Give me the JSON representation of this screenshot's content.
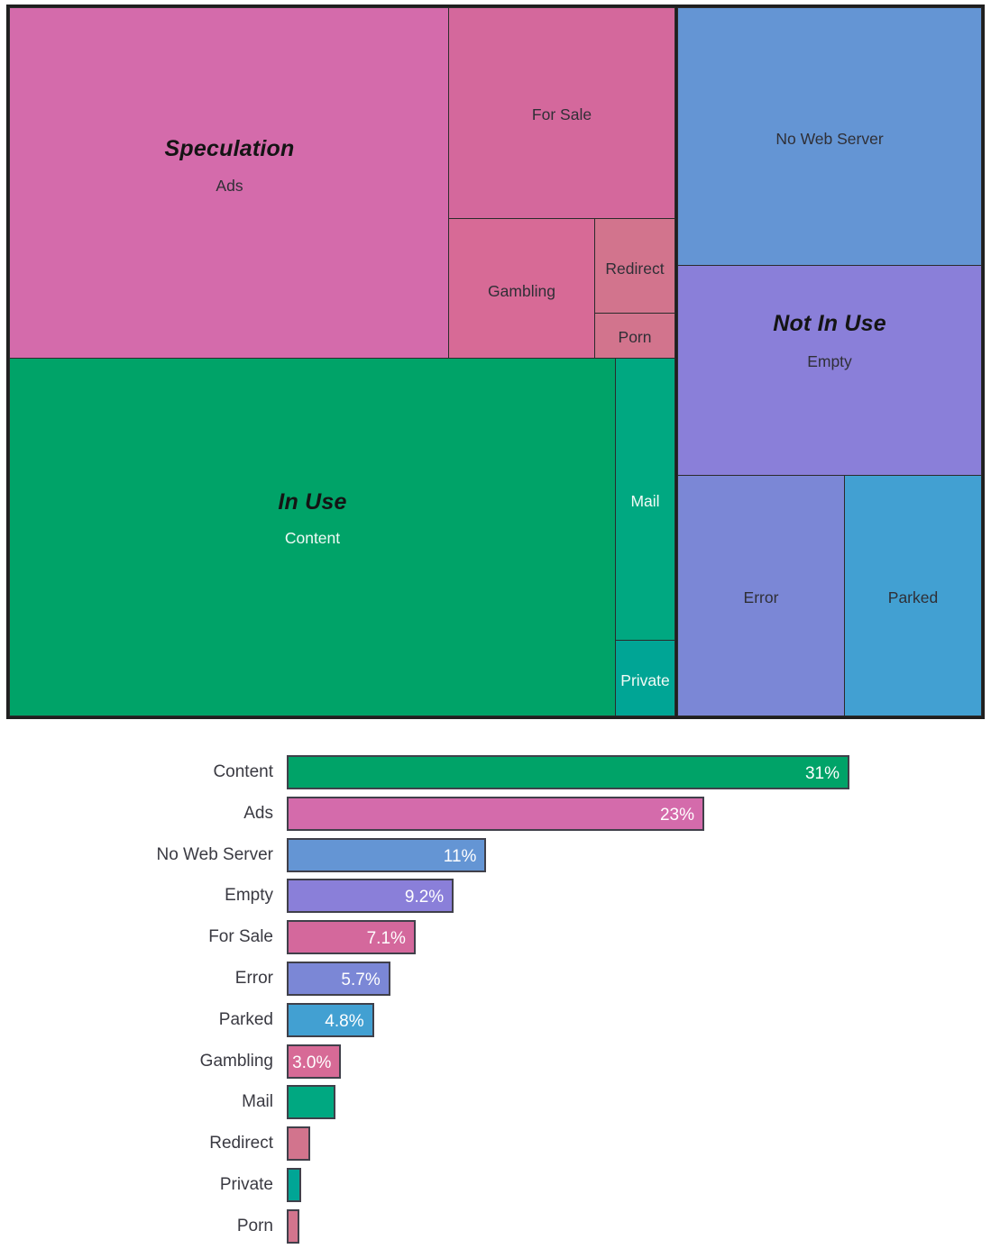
{
  "chart_data": [
    {
      "type": "treemap",
      "title": "",
      "groups": [
        {
          "name": "Speculation",
          "color": "#d46bab",
          "children": [
            {
              "label": "Ads",
              "value": 23,
              "color": "#d46bab",
              "label_color": "dark"
            },
            {
              "label": "For Sale",
              "value": 7.1,
              "color": "#d4689c",
              "label_color": "dark"
            },
            {
              "label": "Gambling",
              "value": 3.0,
              "color": "#d76a96",
              "label_color": "dark"
            },
            {
              "label": "Redirect",
              "value": 1.3,
              "color": "#d2748d",
              "label_color": "dark"
            },
            {
              "label": "Porn",
              "value": 0.7,
              "color": "#d2748d",
              "label_color": "dark"
            }
          ]
        },
        {
          "name": "In Use",
          "color": "#00a368",
          "children": [
            {
              "label": "Content",
              "value": 31,
              "color": "#00a368",
              "label_color": "light"
            },
            {
              "label": "Mail",
              "value": 2.7,
              "color": "#00a881",
              "label_color": "light"
            },
            {
              "label": "Private",
              "value": 0.8,
              "color": "#00a595",
              "label_color": "light"
            }
          ]
        },
        {
          "name": "Not In Use",
          "color": "#8a7fd9",
          "children": [
            {
              "label": "No Web Server",
              "value": 11,
              "color": "#6495d4",
              "label_color": "dark"
            },
            {
              "label": "Empty",
              "value": 9.2,
              "color": "#8a7fd9",
              "label_color": "dark"
            },
            {
              "label": "Error",
              "value": 5.7,
              "color": "#7b87d6",
              "label_color": "dark"
            },
            {
              "label": "Parked",
              "value": 4.8,
              "color": "#42a0d2",
              "label_color": "dark"
            }
          ]
        }
      ],
      "group_labels": [
        "Speculation",
        "In Use",
        "Not In Use"
      ]
    },
    {
      "type": "bar",
      "orientation": "horizontal",
      "title": "",
      "xlabel": "",
      "ylabel": "",
      "grid": false,
      "legend": "none",
      "value_suffix": "%",
      "categories": [
        "Content",
        "Ads",
        "No Web Server",
        "Empty",
        "For Sale",
        "Error",
        "Parked",
        "Gambling",
        "Mail",
        "Redirect",
        "Private",
        "Porn"
      ],
      "values": [
        31,
        23,
        11,
        9.2,
        7.1,
        5.7,
        4.8,
        3.0,
        2.7,
        1.3,
        0.8,
        0.7
      ],
      "value_labels": [
        "31%",
        "23%",
        "11%",
        "9.2%",
        "7.1%",
        "5.7%",
        "4.8%",
        "3.0%",
        "",
        "",
        "",
        ""
      ],
      "colors": [
        "#00a368",
        "#d46bab",
        "#6495d4",
        "#8a7fd9",
        "#d4689c",
        "#7b87d6",
        "#42a0d2",
        "#d76a96",
        "#00a881",
        "#d2748d",
        "#00a595",
        "#d2748d"
      ],
      "xlim": [
        0,
        31
      ]
    }
  ],
  "treemap": {
    "cells": [
      {
        "key": "ads",
        "label": "Ads",
        "group": "Speculation",
        "show_group": true
      },
      {
        "key": "for_sale",
        "label": "For Sale",
        "group": "",
        "show_group": false
      },
      {
        "key": "gambling",
        "label": "Gambling",
        "group": "",
        "show_group": false
      },
      {
        "key": "redirect",
        "label": "Redirect",
        "group": "",
        "show_group": false
      },
      {
        "key": "porn",
        "label": "Porn",
        "group": "",
        "show_group": false
      },
      {
        "key": "content",
        "label": "Content",
        "group": "In Use",
        "show_group": true
      },
      {
        "key": "mail",
        "label": "Mail",
        "group": "",
        "show_group": false
      },
      {
        "key": "private",
        "label": "Private",
        "group": "",
        "show_group": false
      },
      {
        "key": "no_web_server",
        "label": "No Web Server",
        "group": "",
        "show_group": false
      },
      {
        "key": "empty",
        "label": "Empty",
        "group": "Not In Use",
        "show_group": true
      },
      {
        "key": "error",
        "label": "Error",
        "group": "",
        "show_group": false
      },
      {
        "key": "parked",
        "label": "Parked",
        "group": "",
        "show_group": false
      }
    ],
    "labels": {
      "ads": "Ads",
      "for_sale": "For Sale",
      "gambling": "Gambling",
      "redirect": "Redirect",
      "porn": "Porn",
      "content": "Content",
      "mail": "Mail",
      "private": "Private",
      "no_web_server": "No Web Server",
      "empty": "Empty",
      "error": "Error",
      "parked": "Parked",
      "speculation_group": "Speculation",
      "in_use_group": "In Use",
      "not_in_use_group": "Not In Use"
    }
  },
  "bars": {
    "rows": [
      {
        "label": "Content",
        "value_label": "31%"
      },
      {
        "label": "Ads",
        "value_label": "23%"
      },
      {
        "label": "No Web Server",
        "value_label": "11%"
      },
      {
        "label": "Empty",
        "value_label": "9.2%"
      },
      {
        "label": "For Sale",
        "value_label": "7.1%"
      },
      {
        "label": "Error",
        "value_label": "5.7%"
      },
      {
        "label": "Parked",
        "value_label": "4.8%"
      },
      {
        "label": "Gambling",
        "value_label": "3.0%"
      },
      {
        "label": "Mail",
        "value_label": ""
      },
      {
        "label": "Redirect",
        "value_label": ""
      },
      {
        "label": "Private",
        "value_label": ""
      },
      {
        "label": "Porn",
        "value_label": ""
      }
    ]
  }
}
